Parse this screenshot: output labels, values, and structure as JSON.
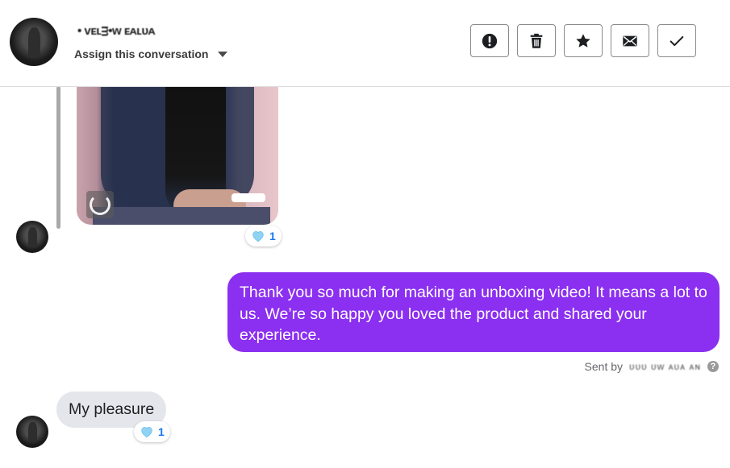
{
  "header": {
    "contact_name": "• ᴠᴇʟᴟ•ᴡ ᴇᴀʟᴜᴀ",
    "assign_label": "Assign this conversation"
  },
  "actions": [
    {
      "icon": "alert-icon",
      "label": "Mark as spam"
    },
    {
      "icon": "trash-icon",
      "label": "Delete"
    },
    {
      "icon": "star-icon",
      "label": "Star"
    },
    {
      "icon": "envelope-icon",
      "label": "Mark as unread"
    },
    {
      "icon": "check-icon",
      "label": "Done"
    }
  ],
  "messages": {
    "media_reaction": {
      "emoji": "light-blue-heart",
      "count": "1"
    },
    "outgoing": {
      "text": "Thank you so much for making an unboxing video! It means a lot to us. We’re so happy you loved the product and shared your experience.",
      "sent_by_label": "Sent by",
      "sent_by_name": "ᴜᴜᴜ ᴜᴡ ᴀᴜᴀ ᴀɴ",
      "help": "?"
    },
    "incoming": {
      "text": "My pleasure",
      "reaction": {
        "emoji": "light-blue-heart",
        "count": "1"
      }
    }
  },
  "colors": {
    "outgoing_bubble": "#8b2ff0",
    "incoming_bubble": "#e4e6eb",
    "reaction_count": "#1877f2",
    "heart": "#8fd3f4"
  }
}
